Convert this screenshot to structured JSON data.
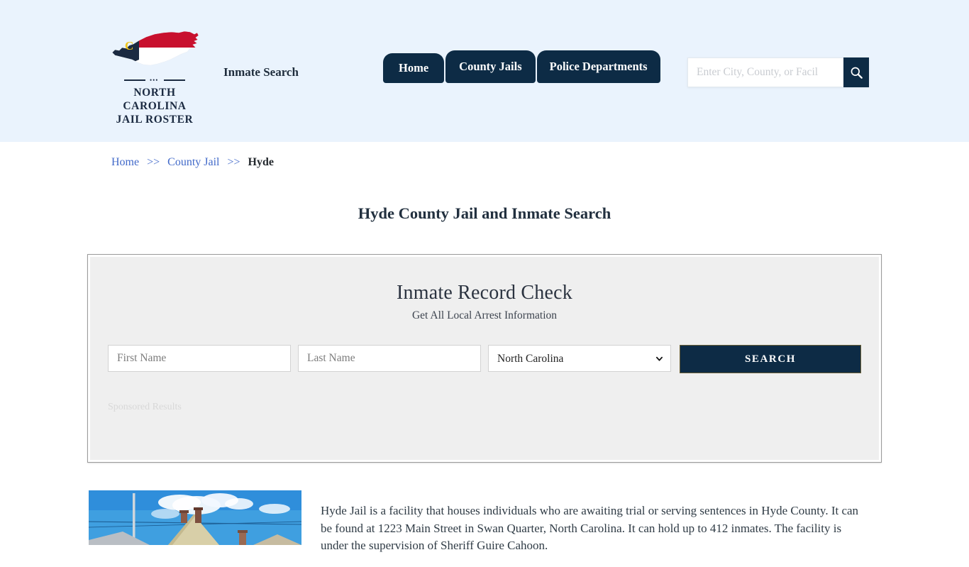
{
  "header": {
    "logo": {
      "icon": "north-carolina-state-map-icon",
      "line1": "NORTH CAROLINA",
      "line2": "JAIL ROSTER",
      "colors": {
        "navy": "#1b2a41",
        "red": "#c8102e",
        "gold": "#f0c419",
        "white": "#ffffff"
      }
    },
    "tagline": "Inmate Search",
    "nav": [
      {
        "label": "Home"
      },
      {
        "label": "County Jails"
      },
      {
        "label": "Police Departments"
      }
    ],
    "search": {
      "placeholder": "Enter City, County, or Facil",
      "value": "",
      "button_icon": "search-icon"
    },
    "background_color": "#eaf3fd"
  },
  "breadcrumb": {
    "items": [
      {
        "label": "Home",
        "current": false
      },
      {
        "label": "County Jail",
        "current": false
      },
      {
        "label": "Hyde",
        "current": true
      }
    ],
    "separator": ">>"
  },
  "page_title": "Hyde County Jail and Inmate Search",
  "widget": {
    "title": "Inmate Record Check",
    "subtitle": "Get All Local Arrest Information",
    "first_name": {
      "placeholder": "First Name",
      "value": ""
    },
    "last_name": {
      "placeholder": "Last Name",
      "value": ""
    },
    "state_select": {
      "value": "North Carolina",
      "options": [
        "North Carolina"
      ],
      "chevron_icon": "chevron-down-icon"
    },
    "search_button": "SEARCH",
    "sponsored_label": "Sponsored Results",
    "accent_color": "#0d2b45"
  },
  "content": {
    "thumbnail_alt": "hyde-county-jail-building-photo",
    "paragraph": "Hyde Jail is a facility that houses individuals who are awaiting trial or serving sentences in Hyde County. It can be found at 1223 Main Street in Swan Quarter, North Carolina. It can hold up to 412 inmates. The facility is under the supervision of Sheriff Guire Cahoon."
  }
}
